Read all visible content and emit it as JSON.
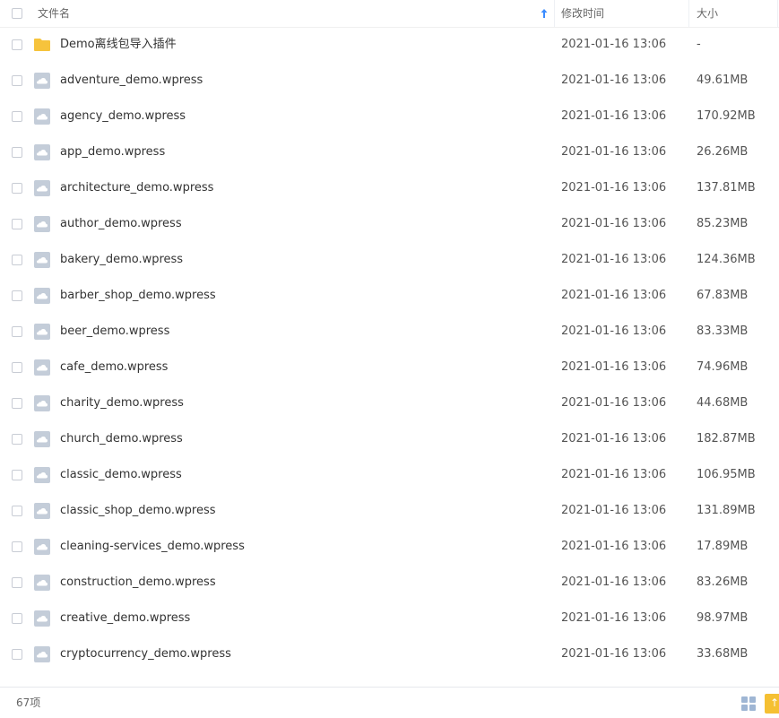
{
  "header": {
    "name_col": "文件名",
    "time_col": "修改时间",
    "size_col": "大小"
  },
  "files": [
    {
      "name": "Demo离线包导入插件",
      "time": "2021-01-16 13:06",
      "size": "-",
      "type": "folder"
    },
    {
      "name": "adventure_demo.wpress",
      "time": "2021-01-16 13:06",
      "size": "49.61MB",
      "type": "file"
    },
    {
      "name": "agency_demo.wpress",
      "time": "2021-01-16 13:06",
      "size": "170.92MB",
      "type": "file"
    },
    {
      "name": "app_demo.wpress",
      "time": "2021-01-16 13:06",
      "size": "26.26MB",
      "type": "file"
    },
    {
      "name": "architecture_demo.wpress",
      "time": "2021-01-16 13:06",
      "size": "137.81MB",
      "type": "file"
    },
    {
      "name": "author_demo.wpress",
      "time": "2021-01-16 13:06",
      "size": "85.23MB",
      "type": "file"
    },
    {
      "name": "bakery_demo.wpress",
      "time": "2021-01-16 13:06",
      "size": "124.36MB",
      "type": "file"
    },
    {
      "name": "barber_shop_demo.wpress",
      "time": "2021-01-16 13:06",
      "size": "67.83MB",
      "type": "file"
    },
    {
      "name": "beer_demo.wpress",
      "time": "2021-01-16 13:06",
      "size": "83.33MB",
      "type": "file"
    },
    {
      "name": "cafe_demo.wpress",
      "time": "2021-01-16 13:06",
      "size": "74.96MB",
      "type": "file"
    },
    {
      "name": "charity_demo.wpress",
      "time": "2021-01-16 13:06",
      "size": "44.68MB",
      "type": "file"
    },
    {
      "name": "church_demo.wpress",
      "time": "2021-01-16 13:06",
      "size": "182.87MB",
      "type": "file"
    },
    {
      "name": "classic_demo.wpress",
      "time": "2021-01-16 13:06",
      "size": "106.95MB",
      "type": "file"
    },
    {
      "name": "classic_shop_demo.wpress",
      "time": "2021-01-16 13:06",
      "size": "131.89MB",
      "type": "file"
    },
    {
      "name": "cleaning-services_demo.wpress",
      "time": "2021-01-16 13:06",
      "size": "17.89MB",
      "type": "file"
    },
    {
      "name": "construction_demo.wpress",
      "time": "2021-01-16 13:06",
      "size": "83.26MB",
      "type": "file"
    },
    {
      "name": "creative_demo.wpress",
      "time": "2021-01-16 13:06",
      "size": "98.97MB",
      "type": "file"
    },
    {
      "name": "cryptocurrency_demo.wpress",
      "time": "2021-01-16 13:06",
      "size": "33.68MB",
      "type": "file"
    }
  ],
  "footer": {
    "count": "67项"
  },
  "colors": {
    "folder": "#f6c33c",
    "file_icon": "#c4cdd9",
    "accent": "#3b8cff",
    "button": "#f5c033"
  },
  "icons": {
    "sort": "arrow-up-icon",
    "folder": "folder-icon",
    "file": "cloud-file-icon",
    "view": "grid-view-icon"
  }
}
